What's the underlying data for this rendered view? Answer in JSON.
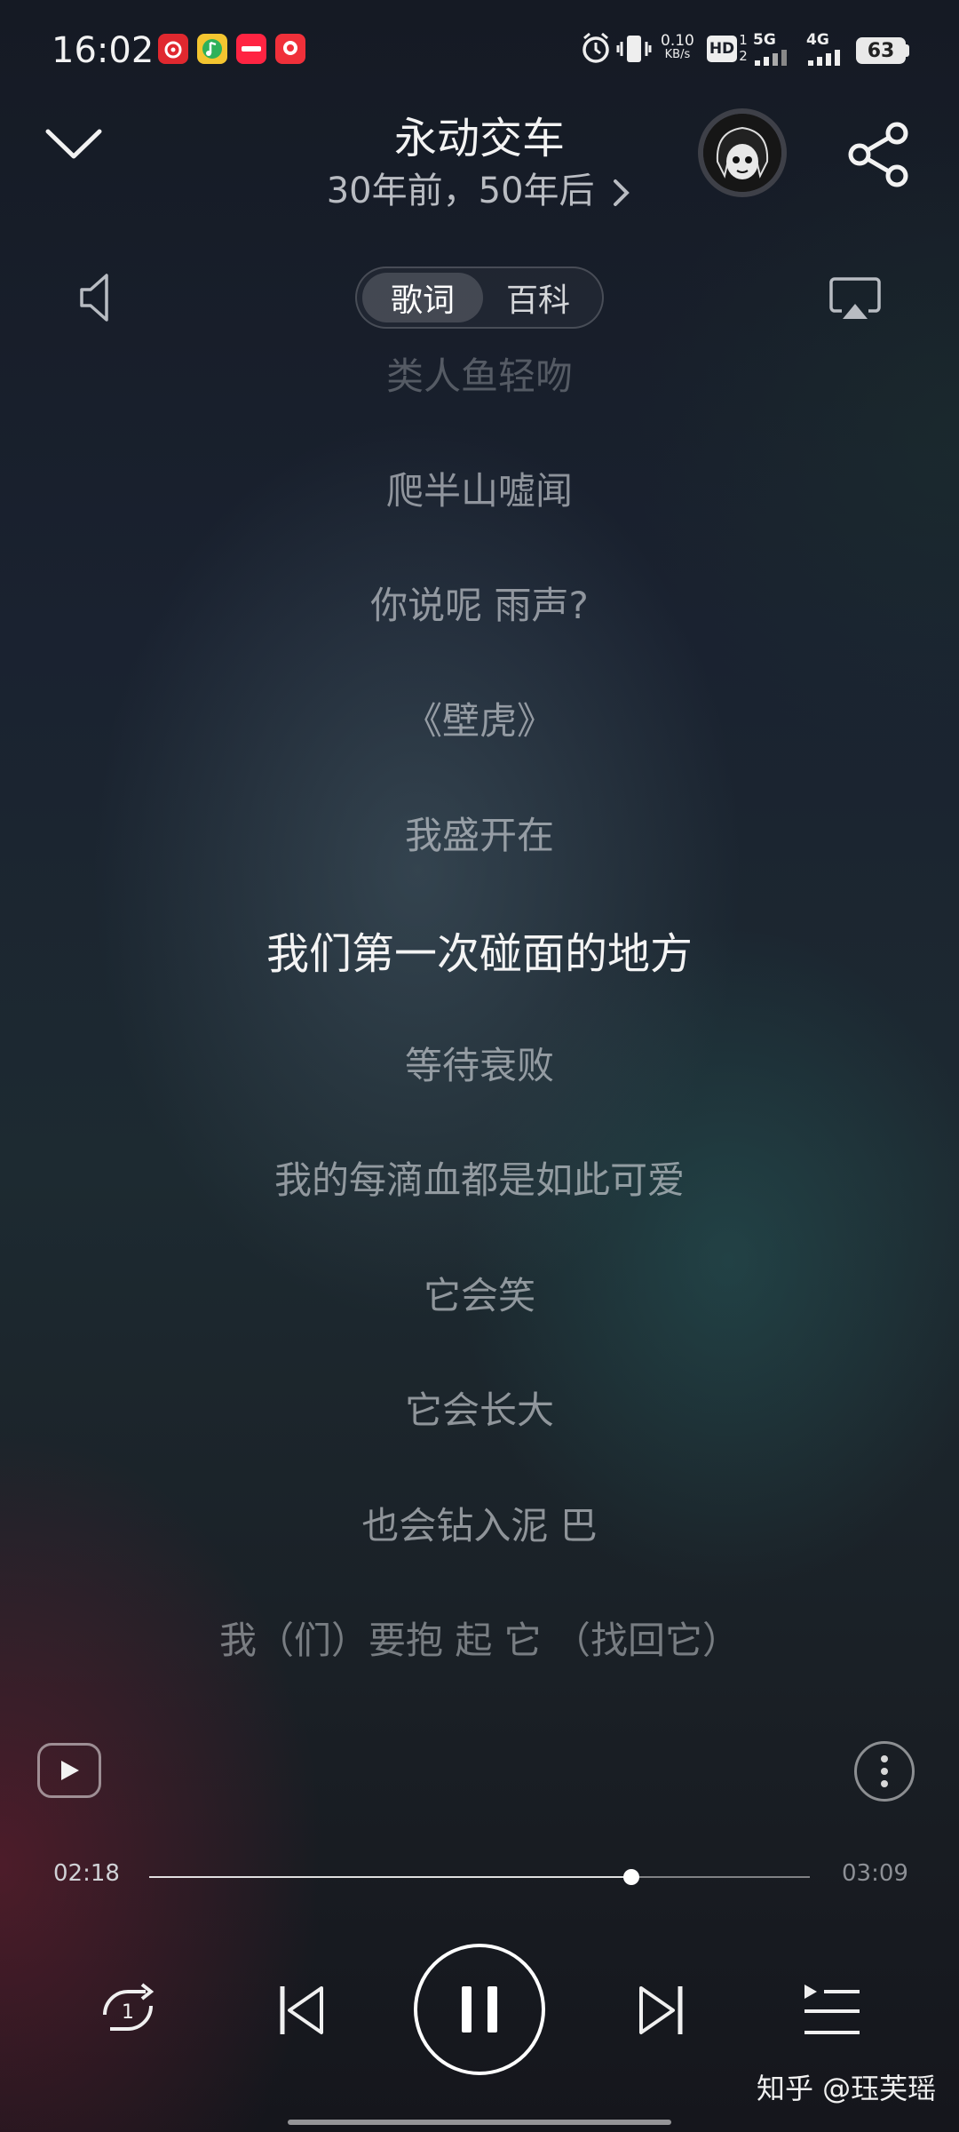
{
  "status_bar": {
    "time": "16:02",
    "speed_value": "0.10",
    "speed_unit": "KB/s",
    "hd": "HD",
    "sim": "1 2",
    "net1": "5G",
    "net2": "4G",
    "battery": "63"
  },
  "header": {
    "song_title": "永动交车",
    "album": "30年前，50年后"
  },
  "tabs": [
    {
      "label": "歌词",
      "active": true
    },
    {
      "label": "百科",
      "active": false
    }
  ],
  "lyrics": {
    "lines": [
      "类人鱼轻吻",
      "爬半山噓闻",
      "你说呢 雨声?",
      "《壁虎》",
      "我盛开在",
      "我们第一次碰面的地方",
      "等待衰败",
      "我的每滴血都是如此可爱",
      "它会笑",
      "它会长大",
      "也会钻入泥 巴",
      "我（们）要抱 起 它 （找回它）"
    ],
    "current_index": 5
  },
  "player": {
    "elapsed": "02:18",
    "duration": "03:09",
    "progress": 0.73,
    "state": "playing"
  },
  "watermark": "知乎 @珏芙瑶",
  "colors": {
    "accent": "#ffffff",
    "muted_lyric": "#d6dade",
    "background_top": "#151a24"
  },
  "icons": [
    "chevron-down-icon",
    "share-icon",
    "volume-icon",
    "airplay-icon",
    "video-play-icon",
    "more-icon",
    "repeat-one-icon",
    "previous-icon",
    "pause-icon",
    "next-icon",
    "playlist-icon"
  ]
}
